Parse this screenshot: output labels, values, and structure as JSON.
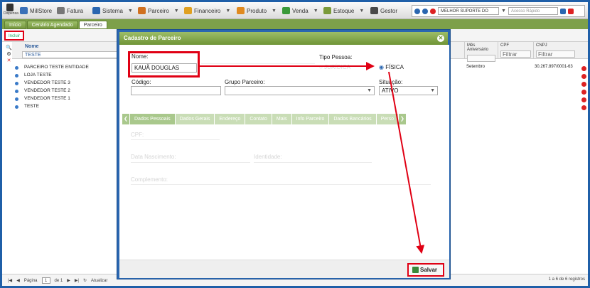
{
  "topbar": {
    "logo_text": "Dispensa",
    "menus": [
      {
        "label": "MillStore",
        "icon": "store-icon",
        "color": "#3a70b8"
      },
      {
        "label": "Fatura",
        "icon": "invoice-icon",
        "color": "#777777"
      },
      {
        "label": "Sistema",
        "icon": "gear-icon",
        "color": "#2a66b0"
      },
      {
        "label": "Parceiro",
        "icon": "partner-icon",
        "color": "#d07020"
      },
      {
        "label": "Financeiro",
        "icon": "finance-icon",
        "color": "#e0a020"
      },
      {
        "label": "Produto",
        "icon": "product-icon",
        "color": "#e08a20"
      },
      {
        "label": "Venda",
        "icon": "cart-icon",
        "color": "#3a9a3a"
      },
      {
        "label": "Estoque",
        "icon": "stock-icon",
        "color": "#7a9a3a"
      },
      {
        "label": "Gestor",
        "icon": "manager-icon",
        "color": "#4a4a4a"
      }
    ],
    "company_select": "MELHOR SUPORTE DO",
    "access_select": "Acesso Rápido"
  },
  "tabs": [
    "Início",
    "Cenário Agendado",
    "Parceiro"
  ],
  "toolbar": {
    "incluir_label": "Incluir"
  },
  "grid": {
    "column_nome": "Nome",
    "filter_value": "TESTE",
    "rows": [
      "PARCEIRO TESTE ENTIDADE",
      "LOJA TESTE",
      "VENDEDOR TESTE 3",
      "VENDEDOR TESTE 2",
      "VENDEDOR TESTE 1",
      "TESTE"
    ],
    "right_columns": [
      {
        "header": "Mês Aniversário",
        "filter": "",
        "row1": "Setembro"
      },
      {
        "header": "CPF",
        "filter": "Filtrar",
        "row1": ""
      },
      {
        "header": "CNPJ",
        "filter": "Filtrar",
        "row1": "30.267.897/0001-63"
      }
    ]
  },
  "footer": {
    "page_label": "Página",
    "page_value": "1",
    "of_label": "de 1",
    "refresh_label": "Atualizar",
    "records": "1 a 6 de 6 registros"
  },
  "modal": {
    "title": "Cadastro de Parceiro",
    "nome_label": "Nome:",
    "nome_value": "KAUÃ DOUGLAS",
    "tipo_label": "Tipo Pessoa:",
    "juridica_label": "JURÍDICA",
    "fisica_label": "FÍSICA",
    "codigo_label": "Código:",
    "codigo_value": "",
    "grupo_label": "Grupo Parceiro:",
    "grupo_value": "",
    "situacao_label": "Situação:",
    "situacao_value": "ATIVO",
    "subtabs": [
      "Dados Pessoais",
      "Dados Gerais",
      "Endereço",
      "Contato",
      "Mais",
      "Info Parceiro",
      "Dados Bancários",
      "Perso"
    ],
    "cpf_label": "CPF:",
    "nasc_label": "Data Nascimento:",
    "identidade_label": "Identidade:",
    "complemento_label": "Complemento:",
    "save_label": "Salvar"
  }
}
